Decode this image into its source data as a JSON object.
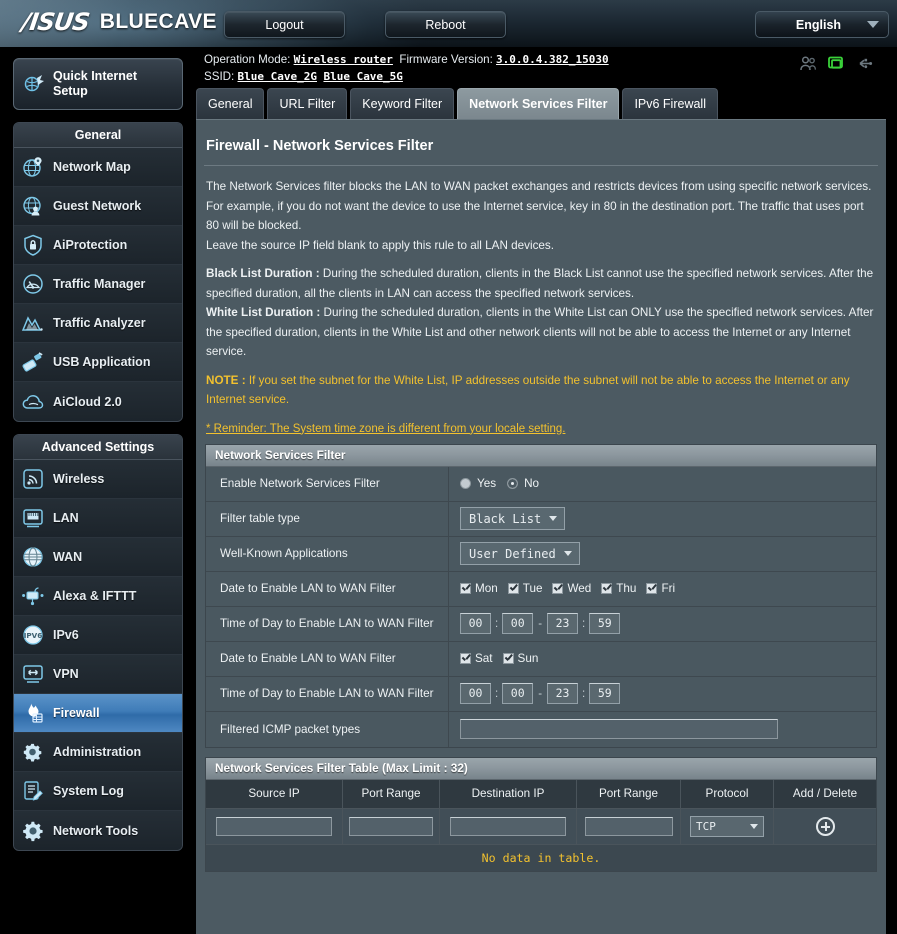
{
  "header": {
    "brand": "/ISUS",
    "model": "BLUECAVE",
    "logout_label": "Logout",
    "reboot_label": "Reboot",
    "language": "English",
    "icons": [
      "clients-icon",
      "display-icon",
      "usb-icon"
    ]
  },
  "info": {
    "operation_mode_label": "Operation Mode:",
    "operation_mode_value": "Wireless router",
    "firmware_label": "Firmware Version:",
    "firmware_value": "3.0.0.4.382_15030",
    "ssid_label": "SSID:",
    "ssid_2g": "Blue Cave_2G",
    "ssid_5g": "Blue Cave_5G"
  },
  "tabs": [
    {
      "label": "General",
      "active": false
    },
    {
      "label": "URL Filter",
      "active": false
    },
    {
      "label": "Keyword Filter",
      "active": false
    },
    {
      "label": "Network Services Filter",
      "active": true
    },
    {
      "label": "IPv6 Firewall",
      "active": false
    }
  ],
  "sidebar": {
    "quick_setup": "Quick Internet Setup",
    "groups": [
      {
        "title": "General",
        "items": [
          {
            "label": "Network Map",
            "icon": "network-map-icon",
            "active": false
          },
          {
            "label": "Guest Network",
            "icon": "guest-network-icon",
            "active": false
          },
          {
            "label": "AiProtection",
            "icon": "shield-lock-icon",
            "active": false
          },
          {
            "label": "Traffic Manager",
            "icon": "gauge-icon",
            "active": false
          },
          {
            "label": "Traffic Analyzer",
            "icon": "chart-peaks-icon",
            "active": false
          },
          {
            "label": "USB Application",
            "icon": "usb-application-icon",
            "active": false
          },
          {
            "label": "AiCloud 2.0",
            "icon": "cloud-icon",
            "active": false
          }
        ]
      },
      {
        "title": "Advanced Settings",
        "items": [
          {
            "label": "Wireless",
            "icon": "wireless-signal-icon",
            "active": false
          },
          {
            "label": "LAN",
            "icon": "lan-port-icon",
            "active": false
          },
          {
            "label": "WAN",
            "icon": "globe-icon",
            "active": false
          },
          {
            "label": "Alexa & IFTTT",
            "icon": "alexa-ifttt-icon",
            "active": false
          },
          {
            "label": "IPv6",
            "icon": "ipv6-globe-icon",
            "active": false
          },
          {
            "label": "VPN",
            "icon": "vpn-monitor-icon",
            "active": false
          },
          {
            "label": "Firewall",
            "icon": "firewall-flame-icon",
            "active": true
          },
          {
            "label": "Administration",
            "icon": "administration-gear-icon",
            "active": false
          },
          {
            "label": "System Log",
            "icon": "system-log-icon",
            "active": false
          },
          {
            "label": "Network Tools",
            "icon": "network-tools-gear-icon",
            "active": false
          }
        ]
      }
    ]
  },
  "main": {
    "page_title": "Firewall - Network Services Filter",
    "description": [
      "The Network Services filter blocks the LAN to WAN packet exchanges and restricts devices from using specific network services.",
      "For example, if you do not want the device to use the Internet service, key in 80 in the destination port. The traffic that uses port 80 will be blocked.",
      "Leave the source IP field blank to apply this rule to all LAN devices."
    ],
    "black_list_label": "Black List Duration :",
    "black_list_text": " During the scheduled duration, clients in the Black List cannot use the specified network services. After the specified duration, all the clients in LAN can access the specified network services.",
    "white_list_label": "White List Duration :",
    "white_list_text": " During the scheduled duration, clients in the White List can ONLY use the specified network services. After the specified duration, clients in the White List and other network clients will not be able to access the Internet or any Internet service.",
    "note_label": "NOTE :",
    "note_text": " If you set the subnet for the White List, IP addresses outside the subnet will not be able to access the Internet or any Internet service.",
    "reminder": "* Reminder: The System time zone is different from your locale setting."
  },
  "filter_section": {
    "title": "Network Services Filter",
    "rows": {
      "enable_label": "Enable Network Services Filter",
      "enable_yes": "Yes",
      "enable_no": "No",
      "enable_selected": "No",
      "table_type_label": "Filter table type",
      "table_type_value": "Black List",
      "apps_label": "Well-Known Applications",
      "apps_value": "User Defined",
      "date_label_1": "Date to Enable LAN to WAN Filter",
      "weekdays": [
        {
          "label": "Mon",
          "checked": true
        },
        {
          "label": "Tue",
          "checked": true
        },
        {
          "label": "Wed",
          "checked": true
        },
        {
          "label": "Thu",
          "checked": true
        },
        {
          "label": "Fri",
          "checked": true
        }
      ],
      "time_label_1": "Time of Day to Enable LAN to WAN Filter",
      "time_1": {
        "start_h": "00",
        "start_m": "00",
        "end_h": "23",
        "end_m": "59"
      },
      "date_label_2": "Date to Enable LAN to WAN Filter",
      "weekend": [
        {
          "label": "Sat",
          "checked": true
        },
        {
          "label": "Sun",
          "checked": true
        }
      ],
      "time_label_2": "Time of Day to Enable LAN to WAN Filter",
      "time_2": {
        "start_h": "00",
        "start_m": "00",
        "end_h": "23",
        "end_m": "59"
      },
      "icmp_label": "Filtered ICMP packet types",
      "icmp_value": ""
    }
  },
  "filter_table": {
    "title": "Network Services Filter Table (Max Limit : 32)",
    "columns": [
      "Source IP",
      "Port Range",
      "Destination IP",
      "Port Range",
      "Protocol",
      "Add / Delete"
    ],
    "input_row": {
      "source_ip": "",
      "source_port": "",
      "dest_ip": "",
      "dest_port": "",
      "protocol": "TCP",
      "action": "add-icon"
    },
    "empty_message": "No data in table."
  },
  "colors": {
    "accent_blue": "#3f7cb8",
    "warning_yellow": "#f2c12e",
    "panel_bg": "#4c5a62",
    "active_green": "#3ad13a"
  }
}
